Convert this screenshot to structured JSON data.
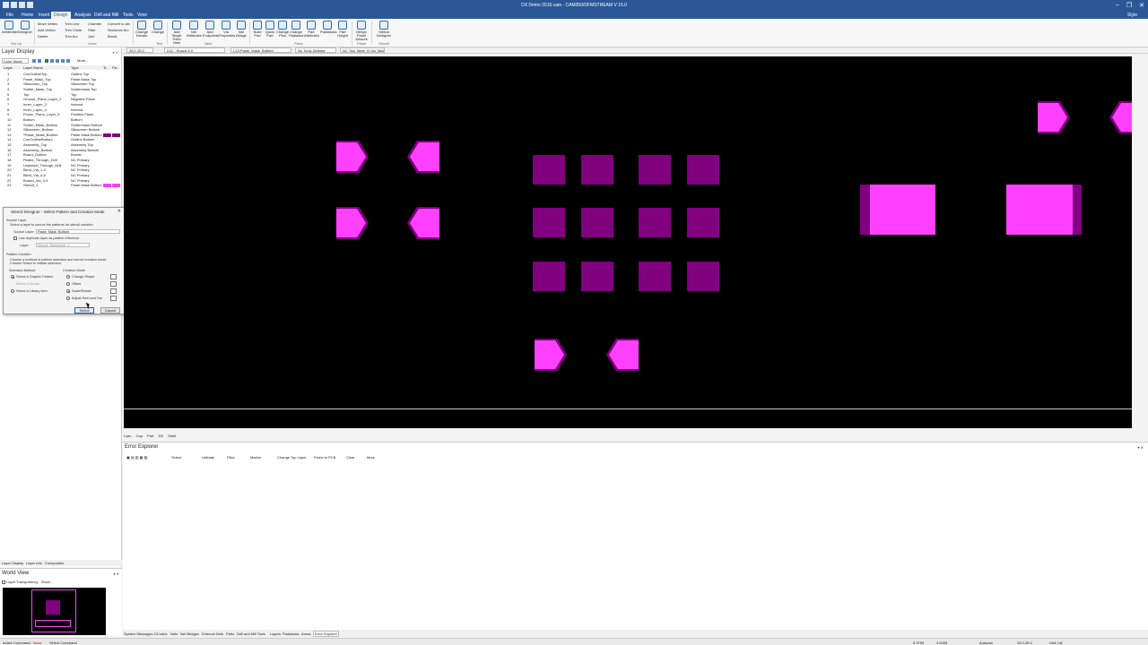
{
  "window": {
    "title": "DX Demo 2016.cam - CAM350/DFMSTREAM V 15.0",
    "controls": [
      "–",
      "❐",
      "✕"
    ]
  },
  "menu": {
    "items": [
      "File",
      "Home",
      "Insert",
      "Design",
      "Analysis",
      "Drill and Mill",
      "Tools",
      "View"
    ],
    "active": "Design",
    "style_label": "Style"
  },
  "ribbon": {
    "setup": {
      "big": [
        "Intellimiter",
        "Designer"
      ],
      "group": "Set Up"
    },
    "edit_small": [
      "Move Vertex",
      "Add Vertex",
      "Delete",
      "Trim Line",
      "Trim Circle",
      "Trim Arc",
      "Chamfer",
      "Fillet",
      "Join",
      "Convert to arc",
      "Sectorize Arc",
      "Break"
    ],
    "lines_group": "Lines",
    "text": {
      "items": [
        "Change Decals",
        "Change"
      ],
      "group": "Text"
    },
    "nets": {
      "items": [
        "Add Single Point Nets",
        "Net Attributes",
        "Add Endpoints",
        "Via Properties",
        "Net Bridge"
      ],
      "group": "Nets"
    },
    "parts": {
      "items": [
        "Build Part",
        "Quick Part",
        "Change Pins",
        "Change Padstack",
        "Part Attributes",
        "Padstacks",
        "Part Height"
      ],
      "group": "Parts"
    },
    "panel": {
      "items": [
        "Merge Panel Artwork"
      ],
      "group": "Panel"
    },
    "stencil": {
      "items": [
        "Stencil Designer"
      ],
      "group": "Stencil"
    }
  },
  "toolrow": {
    "grid": "25.0 25.0",
    "dcode": "D11 · Round 6.0",
    "layer": "L13:Paste_Mask_Bottom",
    "tools": "No Tools Defined",
    "nc_table": "NC Tool Table: IS No Table"
  },
  "layer_display": {
    "title": "Layer Display",
    "mode": "Color Mode",
    "more": "More...",
    "columns": [
      "Layer",
      "Layer Name",
      "Type",
      "Tr..",
      "Pa.."
    ],
    "rows": [
      {
        "num": "1",
        "name": "ConOutlineTop",
        "type": "Outline Top"
      },
      {
        "num": "2",
        "name": "Paste_Mask_Top",
        "type": "Paste Mask Top"
      },
      {
        "num": "3",
        "name": "Silkscreen_Top",
        "type": "Silkscreen Top"
      },
      {
        "num": "4",
        "name": "Solder_Mask_Top",
        "type": "Soldermask Top"
      },
      {
        "num": "5",
        "name": "Top",
        "type": "Top"
      },
      {
        "num": "6",
        "name": "Ground_Plane_Layer_2",
        "type": "Negative Plane"
      },
      {
        "num": "7",
        "name": "Inner_Layer_3",
        "type": "Internal"
      },
      {
        "num": "8",
        "name": "Inner_Layer_4",
        "type": "Internal"
      },
      {
        "num": "9",
        "name": "Power_Plane_Layer_5",
        "type": "Positive Plane"
      },
      {
        "num": "10",
        "name": "Bottom",
        "type": "Bottom"
      },
      {
        "num": "11",
        "name": "Solder_Mask_Bottom",
        "type": "Soldermask Bottom"
      },
      {
        "num": "12",
        "name": "Silkscreen_Bottom",
        "type": "Silkscreen Bottom"
      },
      {
        "num": "13",
        "name": "*Paste_Mask_Bottom",
        "type": "Paste Mask Bottom",
        "swatch": "#800080"
      },
      {
        "num": "14",
        "name": "ConOutlineBottom",
        "type": "Outline Bottom"
      },
      {
        "num": "15",
        "name": "Assembly_Top",
        "type": "Assembly Top"
      },
      {
        "num": "16",
        "name": "Assembly_Bottom",
        "type": "Assembly Bottom"
      },
      {
        "num": "17",
        "name": "Board_Outline",
        "type": "Border"
      },
      {
        "num": "18",
        "name": "Plated_Through_Drill",
        "type": "NC Primary"
      },
      {
        "num": "19",
        "name": "Unplated_Through_Drill",
        "type": "NC Primary"
      },
      {
        "num": "20",
        "name": "Blind_Via_1-3",
        "type": "NC Primary"
      },
      {
        "num": "21",
        "name": "Blind_Via_4-6",
        "type": "NC Primary"
      },
      {
        "num": "22",
        "name": "Buried_Via_3-4",
        "type": "NC Primary"
      },
      {
        "num": "23",
        "name": "Stencil_1",
        "type": "Paste Mask Bottom",
        "swatch": "#ff40ff"
      }
    ]
  },
  "dialog": {
    "title": "Stencil Designer - Select Pattern and Creation Mode",
    "close": "✕",
    "source_layer_heading": "Source Layer",
    "source_layer_hint": "Select a layer to source the patterns for stencil creation",
    "source_layer_label": "Source Layer:",
    "source_layer_value": "Paste_Mask_Bottom",
    "duplicate_label": "Use duplicate layer as pattern reference",
    "layer_label": "Layer:",
    "layer_value": "Stencil_Reference_1",
    "pattern_heading": "Pattern Creation",
    "pattern_hint_1": "Choose a method of pattern selection and stencil creation mode.",
    "pattern_hint_2": "Choose Select to initiate selection.",
    "selection_method_label": "Selection Method",
    "selection_methods": [
      "Select a Graphic Pattern",
      "Select a Dcode",
      "Select a Library Item"
    ],
    "creation_mode_label": "Creation Mode",
    "creation_modes": [
      "Change Shape",
      "Offset",
      "Scale/Rotate",
      "Adjust Heel and Toe"
    ],
    "select_button": "Select",
    "cancel_button": "Cancel"
  },
  "canvas_tabs": [
    "Cam",
    "Cap",
    "Part",
    "DS",
    "Shelf"
  ],
  "error_explorer": {
    "title": "Error Explorer",
    "tools": [
      "Select",
      "Validate",
      "Filter",
      "Marker",
      "Change Top Layer",
      "Probe to PCB",
      "Clear",
      "More"
    ]
  },
  "bottom_tabs": [
    "System Messages",
    "DCodes",
    "Nets",
    "Net Bridges",
    "External Nets",
    "Parts",
    "Drill and Mill Tools",
    "Layers",
    "Padstacks",
    "Areas",
    "Error Explorer"
  ],
  "bottom_active": "Error Explorer",
  "left_tabs": [
    "Layer Display",
    "Layer Info",
    "Composites"
  ],
  "world_view": {
    "title": "World View",
    "transparency": "Layer Transparency",
    "show": "Show..."
  },
  "status": {
    "cmd_label": "Active Command:",
    "cmd_value": "None",
    "prompt": "Select Command",
    "units_label": "Unit: mil",
    "grid_value": "25.0,25.0",
    "coords": [
      "5.3755",
      "4.6305"
    ],
    "autopan": "Autopan"
  },
  "colors": {
    "pad_dark": "#800080",
    "pad_bright": "#ff40ff",
    "accent": "#2b5797"
  }
}
